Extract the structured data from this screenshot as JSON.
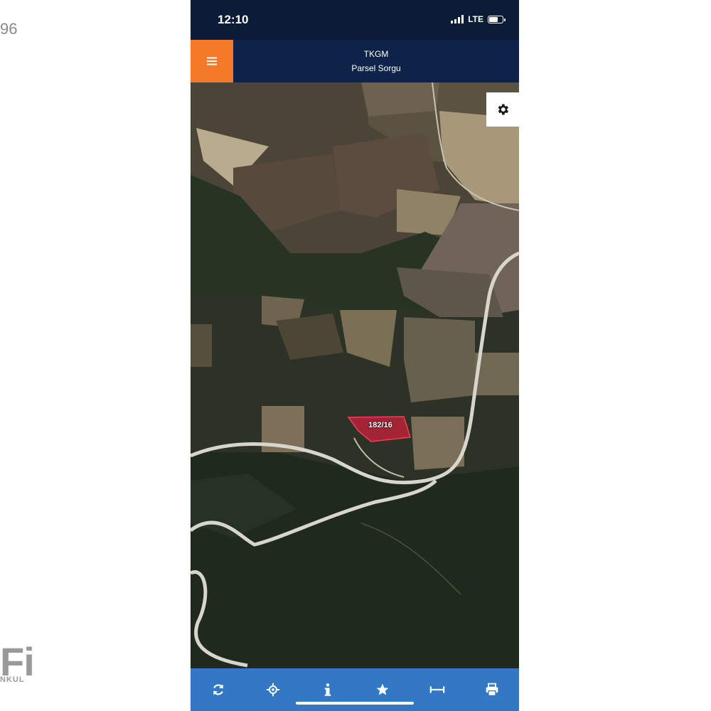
{
  "background": {
    "fragment_number": "96",
    "fragment_logo": "Fi",
    "fragment_sub": "NKUL"
  },
  "status_bar": {
    "time": "12:10",
    "network": "LTE",
    "icons": [
      "signal-icon",
      "battery-icon"
    ]
  },
  "header": {
    "menu_icon": "hamburger-menu-icon",
    "title": "TKGM",
    "subtitle": "Parsel Sorgu"
  },
  "map": {
    "settings_icon": "gear-icon",
    "parcel_label": "182/16",
    "parcel_color": "#c0203a"
  },
  "toolbar": {
    "items": [
      {
        "name": "refresh-icon"
      },
      {
        "name": "locate-icon"
      },
      {
        "name": "info-icon"
      },
      {
        "name": "star-icon"
      },
      {
        "name": "measure-icon"
      },
      {
        "name": "print-icon"
      }
    ]
  },
  "colors": {
    "status_bg": "#0b1d36",
    "header_bg": "#0d2448",
    "menu_accent": "#f47a29",
    "toolbar_bg": "#3378c5"
  }
}
